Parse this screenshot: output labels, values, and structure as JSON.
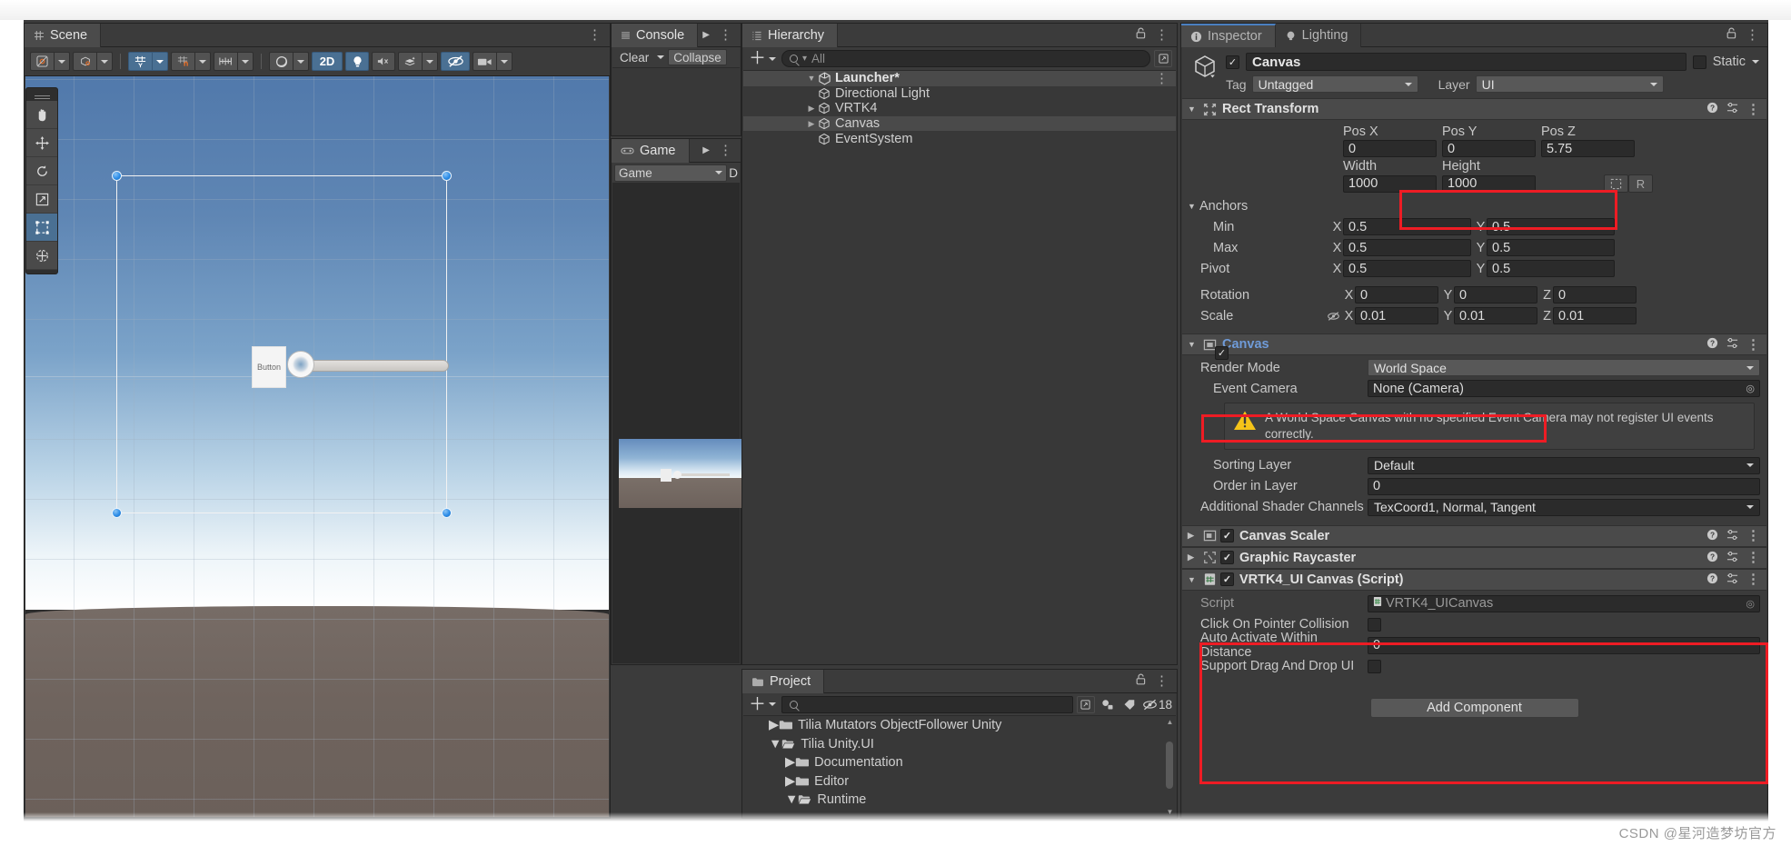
{
  "scene": {
    "tab_label": "Scene",
    "toolbar": {
      "tool_pivot": "pivot-center-toggle",
      "tool_handle": "local-global-toggle",
      "grid_snap": "grid-snapping",
      "magnet_snap": "surface-snapping",
      "increment_snap": "increment-snapping",
      "shading": "shading-mode",
      "twod_label": "2D",
      "lighting": "scene-lighting",
      "audio": "scene-audio",
      "fx": "scene-fx",
      "visibility": "scene-visibility",
      "camera": "scene-camera-settings"
    },
    "tools": [
      "hand-tool",
      "move-tool",
      "rotate-tool",
      "scale-tool",
      "rect-tool",
      "transform-tool"
    ],
    "ui_button_label": "Button"
  },
  "console": {
    "tab_label": "Console",
    "clear_label": "Clear",
    "collapse_label": "Collapse"
  },
  "game": {
    "tab_label": "Game",
    "display_label": "Game",
    "aspect_label": "D"
  },
  "hierarchy": {
    "tab_label": "Hierarchy",
    "search_placeholder": "All",
    "items": [
      {
        "label": "Launcher*",
        "depth": 0,
        "icon": "unity-scene-icon",
        "expanded": true,
        "selected": false,
        "kebab": true
      },
      {
        "label": "Directional Light",
        "depth": 1,
        "icon": "gameobject-icon",
        "expanded": null,
        "selected": false
      },
      {
        "label": "VRTK4",
        "depth": 1,
        "icon": "gameobject-icon",
        "expanded": false,
        "selected": false
      },
      {
        "label": "Canvas",
        "depth": 1,
        "icon": "gameobject-icon",
        "expanded": false,
        "selected": true
      },
      {
        "label": "EventSystem",
        "depth": 1,
        "icon": "gameobject-icon",
        "expanded": null,
        "selected": false
      }
    ]
  },
  "project": {
    "tab_label": "Project",
    "search_placeholder": "",
    "badge_count": "18",
    "items": [
      {
        "label": "Tilia Mutators ObjectFollower Unity",
        "depth": 0,
        "expanded": false
      },
      {
        "label": "Tilia Unity.UI",
        "depth": 0,
        "expanded": true
      },
      {
        "label": "Documentation",
        "depth": 1,
        "expanded": false
      },
      {
        "label": "Editor",
        "depth": 1,
        "expanded": false
      },
      {
        "label": "Runtime",
        "depth": 1,
        "expanded": true
      }
    ]
  },
  "inspector": {
    "tabs": [
      {
        "label": "Inspector",
        "icon": "info-icon",
        "active": true
      },
      {
        "label": "Lighting",
        "icon": "bulb-icon",
        "active": false
      }
    ],
    "object": {
      "name": "Canvas",
      "enabled": true,
      "static_label": "Static",
      "static_checked": false,
      "tag_label": "Tag",
      "tag_value": "Untagged",
      "layer_label": "Layer",
      "layer_value": "UI"
    },
    "rect_transform": {
      "title": "Rect Transform",
      "pos_x_label": "Pos X",
      "pos_x": "0",
      "pos_y_label": "Pos Y",
      "pos_y": "0",
      "pos_z_label": "Pos Z",
      "pos_z": "5.75",
      "width_label": "Width",
      "width": "1000",
      "height_label": "Height",
      "height": "1000",
      "blueprint_btn": "blueprint-mode",
      "raw_btn": "R",
      "anchors_label": "Anchors",
      "min_label": "Min",
      "min_x": "0.5",
      "min_y": "0.5",
      "max_label": "Max",
      "max_x": "0.5",
      "max_y": "0.5",
      "pivot_label": "Pivot",
      "pivot_x": "0.5",
      "pivot_y": "0.5",
      "rotation_label": "Rotation",
      "rot_x": "0",
      "rot_y": "0",
      "rot_z": "0",
      "scale_label": "Scale",
      "scale_x": "0.01",
      "scale_y": "0.01",
      "scale_z": "0.01",
      "axis_x": "X",
      "axis_y": "Y",
      "axis_z": "Z"
    },
    "canvas": {
      "title": "Canvas",
      "enabled": true,
      "render_mode_label": "Render Mode",
      "render_mode_value": "World Space",
      "event_camera_label": "Event Camera",
      "event_camera_value": "None (Camera)",
      "warning_text": "A World Space Canvas with no specified Event Camera may not register UI events correctly.",
      "sorting_layer_label": "Sorting Layer",
      "sorting_layer_value": "Default",
      "order_in_layer_label": "Order in Layer",
      "order_in_layer_value": "0",
      "shader_channels_label": "Additional Shader Channels",
      "shader_channels_value": "TexCoord1, Normal, Tangent"
    },
    "canvas_scaler": {
      "title": "Canvas Scaler",
      "enabled": true
    },
    "graphic_raycaster": {
      "title": "Graphic Raycaster",
      "enabled": true
    },
    "vrtk_script": {
      "title": "VRTK4_UI Canvas (Script)",
      "enabled": true,
      "script_label": "Script",
      "script_value": "VRTK4_UICanvas",
      "click_on_pointer_collision_label": "Click On Pointer Collision",
      "click_on_pointer_collision": false,
      "auto_activate_within_distance_label": "Auto Activate Within Distance",
      "auto_activate_within_distance": "0",
      "support_drag_and_drop_label": "Support Drag And Drop UI",
      "support_drag_and_drop": false
    },
    "add_component_label": "Add Component"
  },
  "annotations": {
    "highlight_color": "#ee1c24",
    "boxes": [
      "width-height-highlight",
      "render-mode-highlight",
      "vrtk-script-highlight"
    ]
  },
  "watermark": "CSDN @星河造梦坊官方"
}
